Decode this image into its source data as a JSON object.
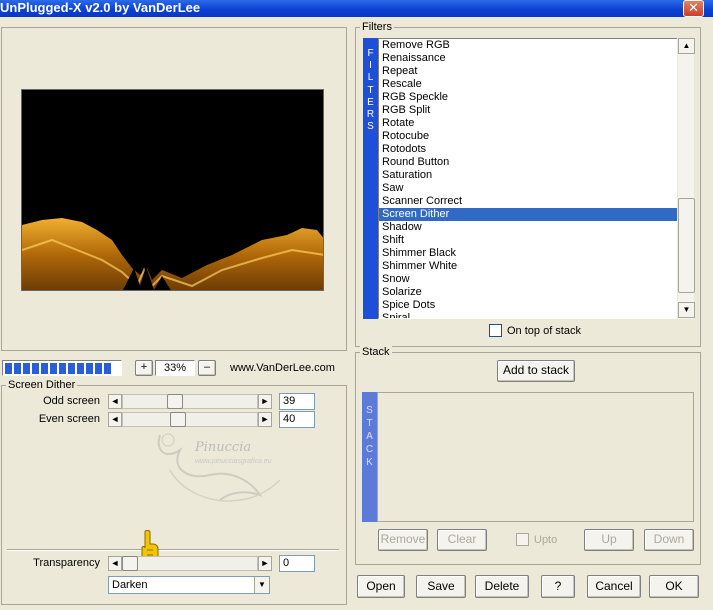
{
  "window": {
    "title": "UnPlugged-X v2.0 by VanDerLee",
    "close_glyph": "✕"
  },
  "zoom": {
    "plus": "+",
    "value": "33%",
    "minus": "–",
    "progress": 0.95,
    "site": "www.VanDerLee.com"
  },
  "params": {
    "group_title": "Screen Dither",
    "odd": {
      "label": "Odd screen",
      "value": "39"
    },
    "even": {
      "label": "Even screen",
      "value": "40"
    },
    "transparency": {
      "label": "Transparency",
      "value": "0"
    },
    "blend_mode": "Darken"
  },
  "watermark": {
    "name": "Pinuccia",
    "url": "www.pinucciasgrafica.eu"
  },
  "filters": {
    "group_title": "Filters",
    "side_label": "FILTERS",
    "items": [
      "Remove RGB",
      "Renaissance",
      "Repeat",
      "Rescale",
      "RGB Speckle",
      "RGB Split",
      "Rotate",
      "Rotocube",
      "Rotodots",
      "Round Button",
      "Saturation",
      "Saw",
      "Scanner Correct",
      "Screen Dither",
      "Shadow",
      "Shift",
      "Shimmer Black",
      "Shimmer White",
      "Snow",
      "Solarize",
      "Spice Dots",
      "Spiral"
    ],
    "selected": "Screen Dither",
    "on_top_label": "On top of stack"
  },
  "stack": {
    "group_title": "Stack",
    "side_label": "STACK",
    "add_label": "Add to stack",
    "remove": "Remove",
    "clear": "Clear",
    "upto": "Upto",
    "up": "Up",
    "down": "Down"
  },
  "buttons": {
    "open": "Open",
    "save": "Save",
    "delete": "Delete",
    "help": "?",
    "cancel": "Cancel",
    "ok": "OK"
  },
  "icons": {
    "scroll_up": "▲",
    "scroll_down": "▼",
    "left": "◄",
    "right": "►",
    "dropdown": "▼"
  },
  "colors": {
    "title_bar": "#0a3fd0",
    "selection": "#316ac5",
    "filters_side": "#1e4fd8",
    "preview_bg": "#000000",
    "preview_gold": "#d08a10"
  }
}
